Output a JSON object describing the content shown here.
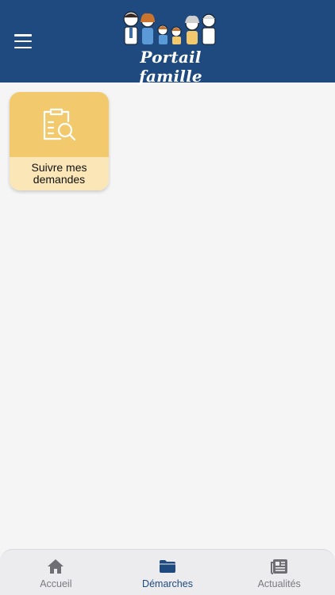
{
  "header": {
    "app_name": "Portail famille",
    "menu_icon": "hamburger-menu-icon",
    "background_color": "#1e4a7f"
  },
  "tiles": [
    {
      "label": "Suivre mes demandes",
      "icon": "clipboard-search-icon",
      "color_top": "#f3c96d",
      "color_bottom": "#fbe6b7"
    }
  ],
  "tabbar": {
    "active": "Démarches",
    "items": [
      {
        "label": "Accueil",
        "icon": "home-icon"
      },
      {
        "label": "Démarches",
        "icon": "folder-icon"
      },
      {
        "label": "Actualités",
        "icon": "newspaper-icon"
      }
    ]
  }
}
